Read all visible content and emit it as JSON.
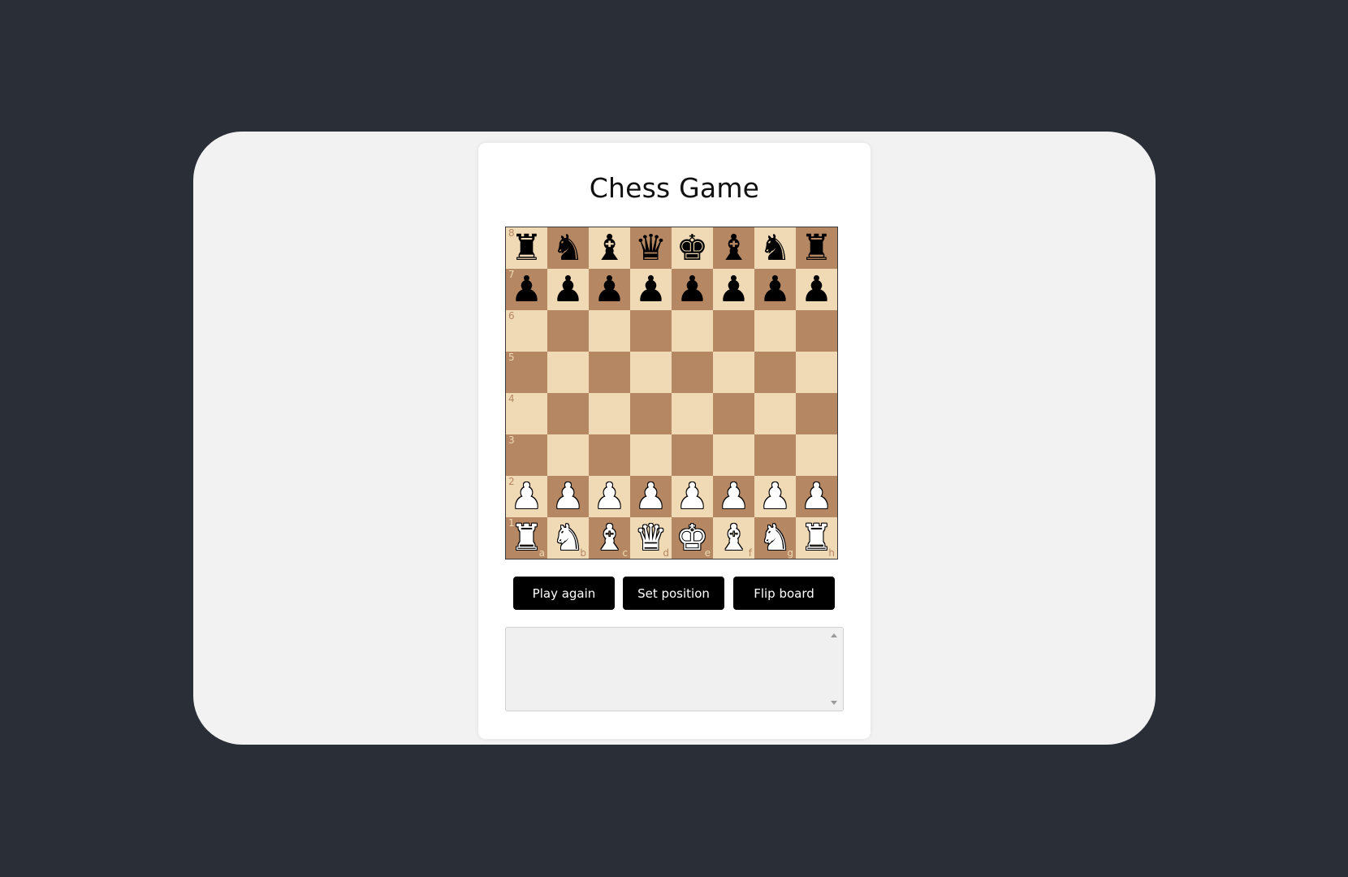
{
  "app": {
    "title": "Chess Game"
  },
  "board": {
    "orientation": "white",
    "colors": {
      "light": "#f0d9b5",
      "dark": "#b58863"
    },
    "files": [
      "a",
      "b",
      "c",
      "d",
      "e",
      "f",
      "g",
      "h"
    ],
    "ranks": [
      "8",
      "7",
      "6",
      "5",
      "4",
      "3",
      "2",
      "1"
    ],
    "rows": [
      [
        "bR",
        "bN",
        "bB",
        "bQ",
        "bK",
        "bB",
        "bN",
        "bR"
      ],
      [
        "bP",
        "bP",
        "bP",
        "bP",
        "bP",
        "bP",
        "bP",
        "bP"
      ],
      [
        "",
        "",
        "",
        "",
        "",
        "",
        "",
        ""
      ],
      [
        "",
        "",
        "",
        "",
        "",
        "",
        "",
        ""
      ],
      [
        "",
        "",
        "",
        "",
        "",
        "",
        "",
        ""
      ],
      [
        "",
        "",
        "",
        "",
        "",
        "",
        "",
        ""
      ],
      [
        "wP",
        "wP",
        "wP",
        "wP",
        "wP",
        "wP",
        "wP",
        "wP"
      ],
      [
        "wR",
        "wN",
        "wB",
        "wQ",
        "wK",
        "wB",
        "wN",
        "wR"
      ]
    ],
    "piece_glyphs": {
      "K": "♚",
      "Q": "♛",
      "R": "♜",
      "B": "♝",
      "N": "♞",
      "P": "♟"
    }
  },
  "controls": {
    "play_again_label": "Play again",
    "set_position_label": "Set position",
    "flip_board_label": "Flip board"
  },
  "log": {
    "value": ""
  },
  "colors": {
    "page_background": "#2a2e37",
    "frame_background": "#f2f2f2",
    "card_background": "#ffffff",
    "button_background": "#000000",
    "button_text": "#ffffff"
  }
}
